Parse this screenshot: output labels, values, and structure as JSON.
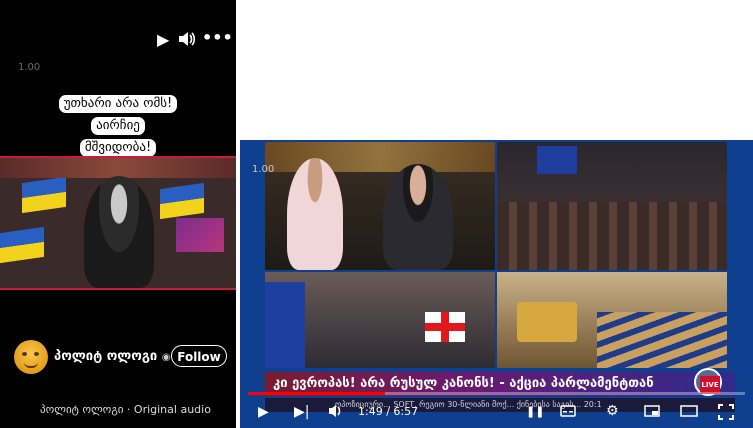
{
  "reel": {
    "speed": "1.00",
    "caption_lines": [
      "უთხარი არა ომს!",
      "აირჩიე",
      "მშვიდობა!"
    ],
    "author": "პოლიტ ოლოგი",
    "follow_label": "Follow",
    "audio_text": "პოლიტ ოლოგი · Original audio"
  },
  "player": {
    "speed": "1.00",
    "headline": "კი ევროპას! არა რუსულ კანონს! - აქცია პარლამენტთან",
    "live": "LIVE",
    "ticker": "ოპოზიციური... SOFT, რეგიო 30-ნლიანი მოქ... ქინებისა საგის... 20:1",
    "time": "1:49 / 6:57",
    "progress_fraction": 0.276
  }
}
